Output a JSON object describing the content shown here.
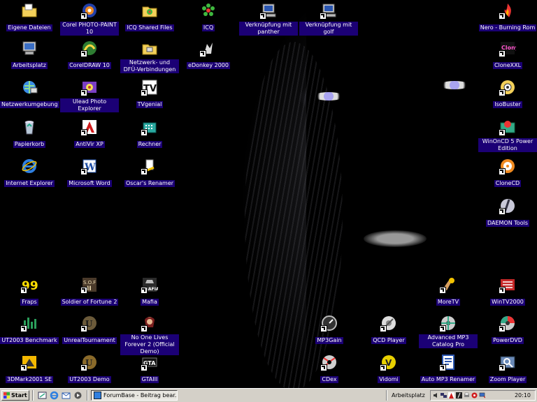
{
  "desktop": {
    "icons": [
      {
        "label": "Eigene Dateien",
        "icon": "my-documents-icon"
      },
      {
        "label": "Corel PHOTO-PAINT 10",
        "icon": "corel-photopaint-icon"
      },
      {
        "label": "ICQ Shared Files",
        "icon": "icq-folder-icon"
      },
      {
        "label": "ICQ",
        "icon": "icq-flower-icon"
      },
      {
        "label": "Verknüpfung mit panther",
        "icon": "network-computer-icon"
      },
      {
        "label": "Verknüpfung mit golf",
        "icon": "network-computer-icon"
      },
      {
        "label": "Nero - Burning Rom",
        "icon": "nero-icon"
      },
      {
        "label": "Arbeitsplatz",
        "icon": "my-computer-icon"
      },
      {
        "label": "CorelDRAW 10",
        "icon": "coreldraw-icon"
      },
      {
        "label": "Netzwerk- und DFÜ-Verbindungen",
        "icon": "network-connections-icon"
      },
      {
        "label": "eDonkey 2000",
        "icon": "edonkey-icon"
      },
      {
        "label": "CloneXXL",
        "icon": "clonexxl-icon"
      },
      {
        "label": "Netzwerkumgebung",
        "icon": "network-places-icon"
      },
      {
        "label": "Ulead Photo Explorer",
        "icon": "ulead-icon"
      },
      {
        "label": "TVgenial",
        "icon": "tvgenial-icon"
      },
      {
        "label": "IsoBuster",
        "icon": "isobuster-icon"
      },
      {
        "label": "Papierkorb",
        "icon": "recycle-bin-icon"
      },
      {
        "label": "AntiVir XP",
        "icon": "antivir-icon"
      },
      {
        "label": "Rechner",
        "icon": "calculator-icon"
      },
      {
        "label": "WinOnCD 5 Power Edition",
        "icon": "winoncd-icon"
      },
      {
        "label": "Internet Explorer",
        "icon": "internet-explorer-icon"
      },
      {
        "label": "Microsoft Word",
        "icon": "word-icon"
      },
      {
        "label": "Oscar's Renamer",
        "icon": "renamer-icon"
      },
      {
        "label": "CloneCD",
        "icon": "clonecd-icon"
      },
      {
        "label": "DAEMON Tools",
        "icon": "daemon-tools-icon"
      },
      {
        "label": "Fraps",
        "icon": "fraps-icon"
      },
      {
        "label": "Soldier of Fortune 2",
        "icon": "sof2-icon"
      },
      {
        "label": "Mafia",
        "icon": "mafia-icon"
      },
      {
        "label": "MoreTV",
        "icon": "moretv-icon"
      },
      {
        "label": "WinTV2000",
        "icon": "wintv-icon"
      },
      {
        "label": "UT2003 Benchmark",
        "icon": "ut2003-benchmark-icon"
      },
      {
        "label": "UnrealTournament",
        "icon": "unreal-icon"
      },
      {
        "label": "No One Lives Forever 2 (Official Demo)",
        "icon": "nolf2-icon"
      },
      {
        "label": "MP3Gain",
        "icon": "mp3gain-icon"
      },
      {
        "label": "QCD Player",
        "icon": "qcd-player-icon"
      },
      {
        "label": "Advanced MP3 Catalog Pro",
        "icon": "mp3-catalog-icon"
      },
      {
        "label": "PowerDVD",
        "icon": "powerdvd-icon"
      },
      {
        "label": "3DMark2001 SE",
        "icon": "3dmark-icon"
      },
      {
        "label": "UT2003 Demo",
        "icon": "ut2003-demo-icon"
      },
      {
        "label": "GTAIII",
        "icon": "gta3-icon"
      },
      {
        "label": "CDex",
        "icon": "cdex-icon"
      },
      {
        "label": "Vidomi",
        "icon": "vidomi-icon"
      },
      {
        "label": "Auto MP3 Renamer",
        "icon": "mp3-renamer-icon"
      },
      {
        "label": "Zoom Player",
        "icon": "zoom-player-icon"
      }
    ]
  },
  "taskbar": {
    "start_label": "Start",
    "quicklaunch": [
      "show-desktop-icon",
      "internet-explorer-icon",
      "outlook-express-icon",
      "media-player-icon"
    ],
    "tasks": [
      {
        "label": "ForumBase - Beitrag bear...",
        "icon": "browser-window-icon"
      }
    ],
    "toolbar_label": "Arbeitsplatz",
    "tray_icons": [
      "volume-icon",
      "network-icon",
      "antivir-tray-icon",
      "daemon-tray-icon",
      "printer-tray-icon",
      "icq-tray-icon",
      "display-tray-icon"
    ],
    "clock": "20:10"
  },
  "colors": {
    "label_bg": "#1b0075",
    "taskbar_bg": "#d4d0c8",
    "eye_highlight": "#a9a4f0"
  }
}
